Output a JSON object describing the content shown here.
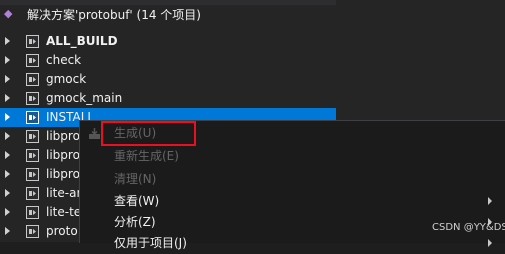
{
  "solution": {
    "label": "解决方案'protobuf' (14 个项目)"
  },
  "projects": [
    {
      "name": "ALL_BUILD",
      "bold": true
    },
    {
      "name": "check"
    },
    {
      "name": "gmock"
    },
    {
      "name": "gmock_main"
    },
    {
      "name": "INSTALL",
      "selected": true
    },
    {
      "name": "libpro"
    },
    {
      "name": "libpro"
    },
    {
      "name": "libpro"
    },
    {
      "name": "lite-ar"
    },
    {
      "name": "lite-te"
    },
    {
      "name": "proto"
    }
  ],
  "context_menu": [
    {
      "label": "生成(U)",
      "disabled": true,
      "icon": "build-icon"
    },
    {
      "label": "重新生成(E)",
      "disabled": true
    },
    {
      "label": "清理(N)",
      "disabled": true
    },
    {
      "label": "查看(W)",
      "submenu": true
    },
    {
      "label": "分析(Z)",
      "submenu": true
    },
    {
      "label": "仅用于项目(J)",
      "submenu": true
    }
  ],
  "watermark": "CSDN @YY&DS",
  "colors": {
    "selection": "#0078d7",
    "highlight_box": "#e81123",
    "background": "#252526"
  }
}
